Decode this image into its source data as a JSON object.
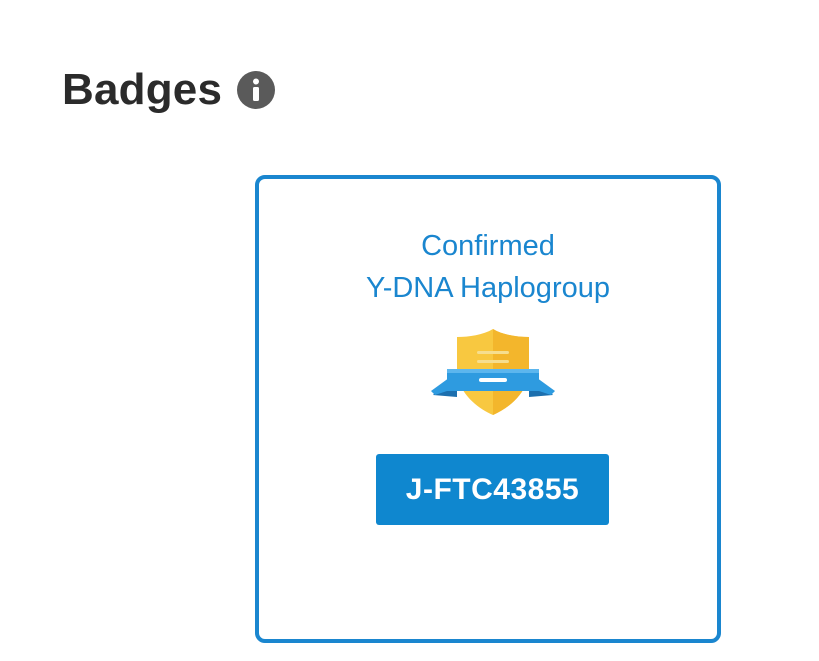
{
  "header": {
    "title": "Badges",
    "info_icon": "info-icon"
  },
  "badge_card": {
    "title_line1": "Confirmed",
    "title_line2": "Y-DNA Haplogroup",
    "emblem_icon": "shield-ribbon-icon",
    "haplogroup": "J-FTC43855"
  },
  "colors": {
    "accent": "#1A86CF",
    "heading": "#2B2B2B",
    "info_icon": "#5A5A5A",
    "shield": "#F8C840",
    "ribbon": "#2E9BE0"
  }
}
